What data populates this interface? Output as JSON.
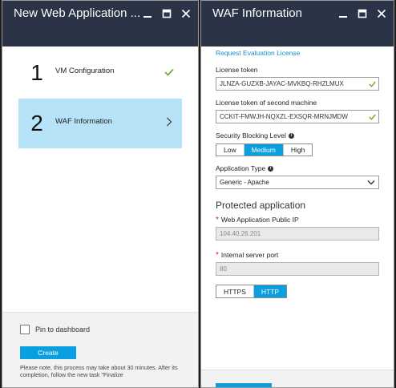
{
  "left_blade": {
    "title": "New Web Application ...",
    "steps": [
      {
        "number": "1",
        "label": "VM Configuration",
        "status": "complete"
      },
      {
        "number": "2",
        "label": "WAF Information",
        "status": "active"
      }
    ],
    "footer": {
      "pin_label": "Pin to dashboard",
      "pin_checked": false,
      "create_label": "Create",
      "note": "Please note, this process may take about 30 minutes. After its completion, follow the new task \"Finalize"
    }
  },
  "right_blade": {
    "title": "WAF Information",
    "request_link": "Request Evaluation License",
    "license_token": {
      "label": "License token",
      "value": "JLNZA-GUZXB-JAYAC-MVKBQ-RHZLMUX"
    },
    "license_token_second": {
      "label": "License token of second machine",
      "value": "CCKIT-FMWJH-NQXZL-EXSQR-MRNJMDW"
    },
    "security_blocking": {
      "label": "Security Blocking Level",
      "options": [
        "Low",
        "Medium",
        "High"
      ],
      "selected": "Medium"
    },
    "application_type": {
      "label": "Application Type",
      "value": "Generic - Apache"
    },
    "protected_section_title": "Protected application",
    "public_ip": {
      "label": "Web Application Public IP",
      "value": "104.40.26.201"
    },
    "server_port": {
      "label": "Internal server port",
      "value": "80"
    },
    "protocol": {
      "options": [
        "HTTPS",
        "HTTP"
      ],
      "selected": "HTTP"
    }
  },
  "colors": {
    "header_bg": "#2b3346",
    "accent": "#0a9fe0",
    "active_step_bg": "#b6e3f7",
    "success_check": "#6fae2f",
    "required_star": "#c8202a"
  },
  "icons": [
    "minimize-icon",
    "maximize-icon",
    "close-icon",
    "checkmark-icon",
    "chevron-right-icon",
    "info-icon",
    "chevron-down-icon"
  ]
}
